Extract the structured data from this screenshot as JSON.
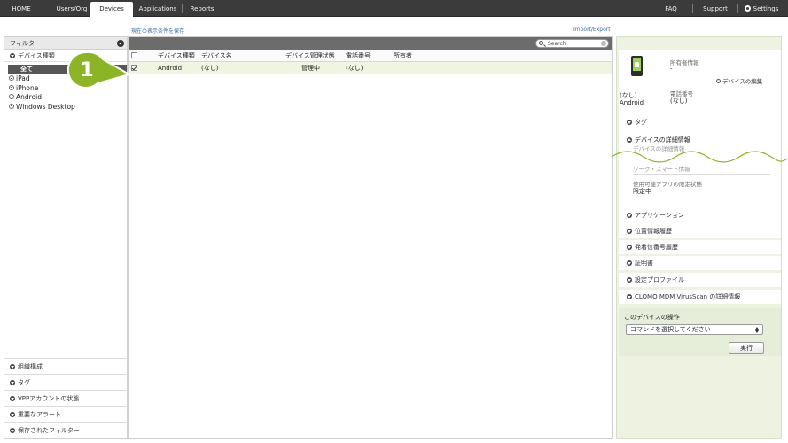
{
  "nav": {
    "tabs": [
      {
        "label": "HOME"
      },
      {
        "label": "Users/Org"
      },
      {
        "label": "Devices"
      },
      {
        "label": "Applications"
      },
      {
        "label": "Reports"
      }
    ],
    "right": {
      "faq": "FAQ",
      "support": "Support",
      "settings": "Settings"
    }
  },
  "links": {
    "save_conditions": "現在の表示条件を保存",
    "import_export": "Import/Export"
  },
  "sidebar": {
    "title": "フィルター",
    "section_device_type": "デバイス種類",
    "all": "全て",
    "items": [
      "iPad",
      "iPhone",
      "Android",
      "Windows Desktop"
    ],
    "bottom": [
      "組織構成",
      "タグ",
      "VPPアカウントの状態",
      "重要なアラート",
      "保存されたフィルター"
    ]
  },
  "table": {
    "search_placeholder": "Search",
    "headers": {
      "type": "デバイス種類",
      "name": "デバイス名",
      "status": "デバイス管理状態",
      "phone": "電話番号",
      "owner": "所有者"
    },
    "rows": [
      {
        "type": "Android",
        "name": "(なし)",
        "status": "管理中",
        "phone": "(なし)",
        "owner": ""
      }
    ]
  },
  "callout": {
    "number": "1",
    "color": "#8cb526"
  },
  "right": {
    "owner_label": "所有者情報",
    "owner_value": "-",
    "name": "(なし)",
    "type": "Android",
    "edit": "デバイスの編集",
    "phone_label": "電話番号",
    "phone_value": "(なし)",
    "tag": "タグ",
    "details_title": "デバイスの詳細情報",
    "details_sub": "デバイスの詳細情報",
    "work_smart": "ワーク・スマート情報",
    "app_restrict_label": "使用可能アプリの限定状態",
    "app_restrict_value": "限定中",
    "sections": [
      "アプリケーション",
      "位置情報履歴",
      "発着信番号履歴",
      "証明書",
      "設定プロファイル",
      "CLOMO MDM VirusScan の詳細情報"
    ],
    "ops_title": "このデバイスの操作",
    "ops_select": "コマンドを選択してください",
    "ops_button": "実行"
  }
}
